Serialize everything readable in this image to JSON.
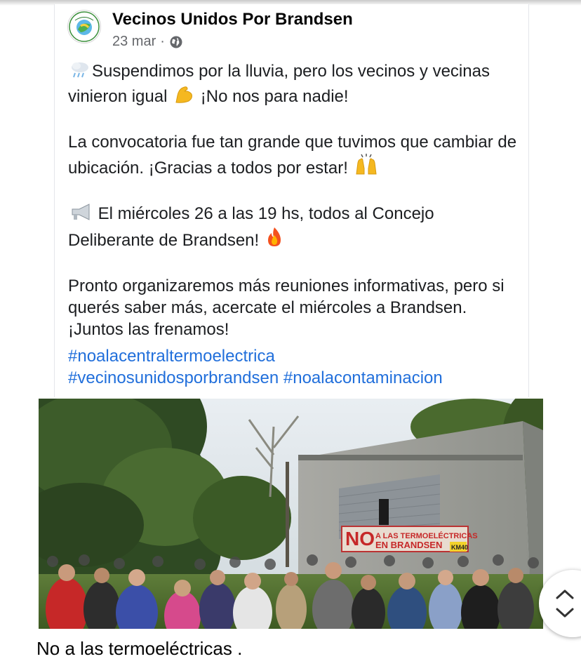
{
  "post": {
    "author": "Vecinos Unidos Por Brandsen",
    "date": "23 mar",
    "separator": "·",
    "privacy_icon": "globe-icon",
    "paragraph1_a": "Suspendimos por la lluvia, pero los vecinos y vecinas vinieron igual",
    "paragraph1_b": "¡No nos para nadie!",
    "paragraph2": "La convocatoria fue tan grande que tuvimos que cambiar de ubicación. ¡Gracias a todos por estar!",
    "paragraph3_a": "El miércoles 26 a las 19 hs, todos al Concejo Deliberante de Brandsen!",
    "paragraph4": "Pronto organizaremos más reuniones informativas, pero si querés saber más, acercate el miércoles a Brandsen. ¡Juntos las frenamos!",
    "hashtags": [
      "#noalacentraltermoelectrica",
      "#vecinosunidosporbrandsen",
      "#noalacontaminacion"
    ],
    "emojis": {
      "rain": "cloud-rain-icon",
      "muscle": "flexed-biceps-icon",
      "hands": "raised-hands-icon",
      "megaphone": "megaphone-icon",
      "fire": "fire-icon"
    }
  },
  "photo": {
    "banner_text": "NO A LAS TERMOELÉCTRICAS EN BRANDSEN",
    "banner_tag": "KM 40"
  },
  "caption": "No a las termoeléctricas .",
  "colors": {
    "hashtag": "#216fdb",
    "meta": "#65676b",
    "text": "#1c1e21"
  }
}
